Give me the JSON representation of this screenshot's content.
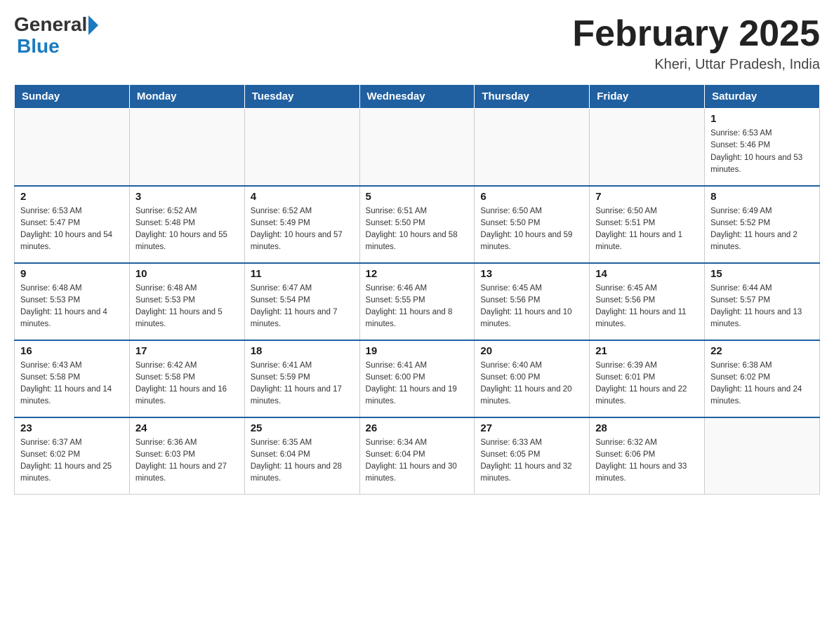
{
  "header": {
    "logo_general": "General",
    "logo_blue": "Blue",
    "title": "February 2025",
    "subtitle": "Kheri, Uttar Pradesh, India"
  },
  "days_of_week": [
    "Sunday",
    "Monday",
    "Tuesday",
    "Wednesday",
    "Thursday",
    "Friday",
    "Saturday"
  ],
  "weeks": [
    [
      {
        "day": "",
        "sunrise": "",
        "sunset": "",
        "daylight": ""
      },
      {
        "day": "",
        "sunrise": "",
        "sunset": "",
        "daylight": ""
      },
      {
        "day": "",
        "sunrise": "",
        "sunset": "",
        "daylight": ""
      },
      {
        "day": "",
        "sunrise": "",
        "sunset": "",
        "daylight": ""
      },
      {
        "day": "",
        "sunrise": "",
        "sunset": "",
        "daylight": ""
      },
      {
        "day": "",
        "sunrise": "",
        "sunset": "",
        "daylight": ""
      },
      {
        "day": "1",
        "sunrise": "Sunrise: 6:53 AM",
        "sunset": "Sunset: 5:46 PM",
        "daylight": "Daylight: 10 hours and 53 minutes."
      }
    ],
    [
      {
        "day": "2",
        "sunrise": "Sunrise: 6:53 AM",
        "sunset": "Sunset: 5:47 PM",
        "daylight": "Daylight: 10 hours and 54 minutes."
      },
      {
        "day": "3",
        "sunrise": "Sunrise: 6:52 AM",
        "sunset": "Sunset: 5:48 PM",
        "daylight": "Daylight: 10 hours and 55 minutes."
      },
      {
        "day": "4",
        "sunrise": "Sunrise: 6:52 AM",
        "sunset": "Sunset: 5:49 PM",
        "daylight": "Daylight: 10 hours and 57 minutes."
      },
      {
        "day": "5",
        "sunrise": "Sunrise: 6:51 AM",
        "sunset": "Sunset: 5:50 PM",
        "daylight": "Daylight: 10 hours and 58 minutes."
      },
      {
        "day": "6",
        "sunrise": "Sunrise: 6:50 AM",
        "sunset": "Sunset: 5:50 PM",
        "daylight": "Daylight: 10 hours and 59 minutes."
      },
      {
        "day": "7",
        "sunrise": "Sunrise: 6:50 AM",
        "sunset": "Sunset: 5:51 PM",
        "daylight": "Daylight: 11 hours and 1 minute."
      },
      {
        "day": "8",
        "sunrise": "Sunrise: 6:49 AM",
        "sunset": "Sunset: 5:52 PM",
        "daylight": "Daylight: 11 hours and 2 minutes."
      }
    ],
    [
      {
        "day": "9",
        "sunrise": "Sunrise: 6:48 AM",
        "sunset": "Sunset: 5:53 PM",
        "daylight": "Daylight: 11 hours and 4 minutes."
      },
      {
        "day": "10",
        "sunrise": "Sunrise: 6:48 AM",
        "sunset": "Sunset: 5:53 PM",
        "daylight": "Daylight: 11 hours and 5 minutes."
      },
      {
        "day": "11",
        "sunrise": "Sunrise: 6:47 AM",
        "sunset": "Sunset: 5:54 PM",
        "daylight": "Daylight: 11 hours and 7 minutes."
      },
      {
        "day": "12",
        "sunrise": "Sunrise: 6:46 AM",
        "sunset": "Sunset: 5:55 PM",
        "daylight": "Daylight: 11 hours and 8 minutes."
      },
      {
        "day": "13",
        "sunrise": "Sunrise: 6:45 AM",
        "sunset": "Sunset: 5:56 PM",
        "daylight": "Daylight: 11 hours and 10 minutes."
      },
      {
        "day": "14",
        "sunrise": "Sunrise: 6:45 AM",
        "sunset": "Sunset: 5:56 PM",
        "daylight": "Daylight: 11 hours and 11 minutes."
      },
      {
        "day": "15",
        "sunrise": "Sunrise: 6:44 AM",
        "sunset": "Sunset: 5:57 PM",
        "daylight": "Daylight: 11 hours and 13 minutes."
      }
    ],
    [
      {
        "day": "16",
        "sunrise": "Sunrise: 6:43 AM",
        "sunset": "Sunset: 5:58 PM",
        "daylight": "Daylight: 11 hours and 14 minutes."
      },
      {
        "day": "17",
        "sunrise": "Sunrise: 6:42 AM",
        "sunset": "Sunset: 5:58 PM",
        "daylight": "Daylight: 11 hours and 16 minutes."
      },
      {
        "day": "18",
        "sunrise": "Sunrise: 6:41 AM",
        "sunset": "Sunset: 5:59 PM",
        "daylight": "Daylight: 11 hours and 17 minutes."
      },
      {
        "day": "19",
        "sunrise": "Sunrise: 6:41 AM",
        "sunset": "Sunset: 6:00 PM",
        "daylight": "Daylight: 11 hours and 19 minutes."
      },
      {
        "day": "20",
        "sunrise": "Sunrise: 6:40 AM",
        "sunset": "Sunset: 6:00 PM",
        "daylight": "Daylight: 11 hours and 20 minutes."
      },
      {
        "day": "21",
        "sunrise": "Sunrise: 6:39 AM",
        "sunset": "Sunset: 6:01 PM",
        "daylight": "Daylight: 11 hours and 22 minutes."
      },
      {
        "day": "22",
        "sunrise": "Sunrise: 6:38 AM",
        "sunset": "Sunset: 6:02 PM",
        "daylight": "Daylight: 11 hours and 24 minutes."
      }
    ],
    [
      {
        "day": "23",
        "sunrise": "Sunrise: 6:37 AM",
        "sunset": "Sunset: 6:02 PM",
        "daylight": "Daylight: 11 hours and 25 minutes."
      },
      {
        "day": "24",
        "sunrise": "Sunrise: 6:36 AM",
        "sunset": "Sunset: 6:03 PM",
        "daylight": "Daylight: 11 hours and 27 minutes."
      },
      {
        "day": "25",
        "sunrise": "Sunrise: 6:35 AM",
        "sunset": "Sunset: 6:04 PM",
        "daylight": "Daylight: 11 hours and 28 minutes."
      },
      {
        "day": "26",
        "sunrise": "Sunrise: 6:34 AM",
        "sunset": "Sunset: 6:04 PM",
        "daylight": "Daylight: 11 hours and 30 minutes."
      },
      {
        "day": "27",
        "sunrise": "Sunrise: 6:33 AM",
        "sunset": "Sunset: 6:05 PM",
        "daylight": "Daylight: 11 hours and 32 minutes."
      },
      {
        "day": "28",
        "sunrise": "Sunrise: 6:32 AM",
        "sunset": "Sunset: 6:06 PM",
        "daylight": "Daylight: 11 hours and 33 minutes."
      },
      {
        "day": "",
        "sunrise": "",
        "sunset": "",
        "daylight": ""
      }
    ]
  ]
}
